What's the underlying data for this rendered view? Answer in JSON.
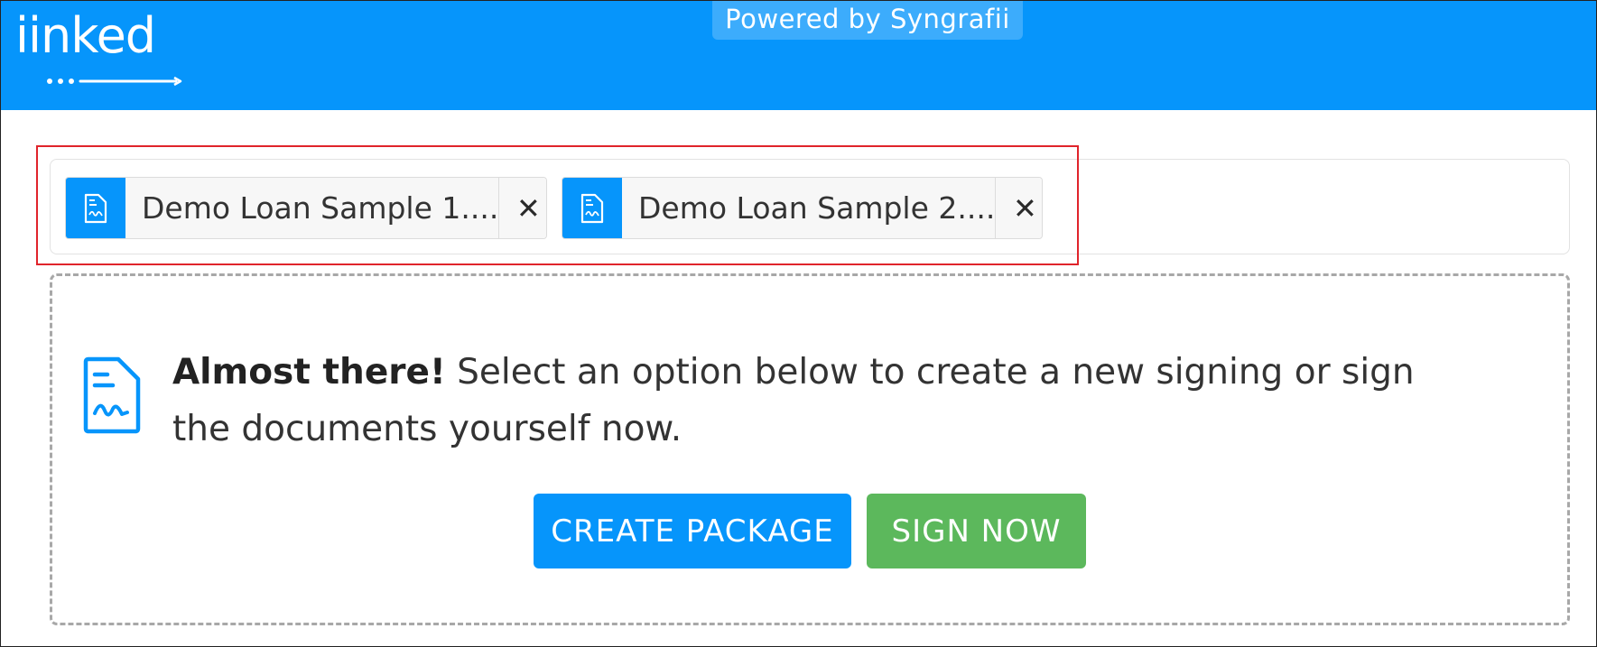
{
  "header": {
    "logo_text": "iinked",
    "powered_by": "Powered by Syngrafii",
    "brand_color": "#0695fb"
  },
  "documents": [
    {
      "name": "Demo Loan Sample 1....",
      "icon": "signed-document-icon",
      "close_label": "✕"
    },
    {
      "name": "Demo Loan Sample 2....",
      "icon": "signed-document-icon",
      "close_label": "✕"
    }
  ],
  "info": {
    "icon": "signed-document-icon",
    "emphasis": "Almost there!",
    "message": " Select an option below to create a new signing or sign the documents yourself now."
  },
  "actions": {
    "create_package_label": "CREATE PACKAGE",
    "sign_now_label": "SIGN NOW",
    "create_color": "#0695fb",
    "sign_color": "#5cb85c"
  },
  "highlight_color": "#e0242b"
}
